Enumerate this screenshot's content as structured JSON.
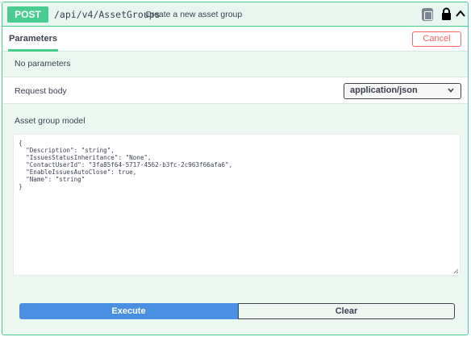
{
  "operation": {
    "method": "POST",
    "path": "/api/v4/AssetGroups",
    "summary": "Create a new asset group",
    "icons": [
      "copy-icon",
      "lock-icon",
      "chevron-up-icon"
    ]
  },
  "tabs": {
    "parameters_label": "Parameters",
    "cancel_label": "Cancel"
  },
  "parameters": {
    "empty_text": "No parameters"
  },
  "request_body": {
    "label": "Request body",
    "content_type": "application/json"
  },
  "model": {
    "label": "Asset group model",
    "json_text": "{\n  \"Description\": \"string\",\n  \"IssuesStatusInheritance\": \"None\",\n  \"ContactUserId\": \"3fa85f64-5717-4562-b3fc-2c963f66afa6\",\n  \"EnableIssuesAutoClose\": true,\n  \"Name\": \"string\"\n}"
  },
  "actions": {
    "execute_label": "Execute",
    "clear_label": "Clear"
  },
  "colors": {
    "post_accent": "#49cc90",
    "execute_blue": "#4990e2",
    "cancel_red": "#ff6060"
  }
}
